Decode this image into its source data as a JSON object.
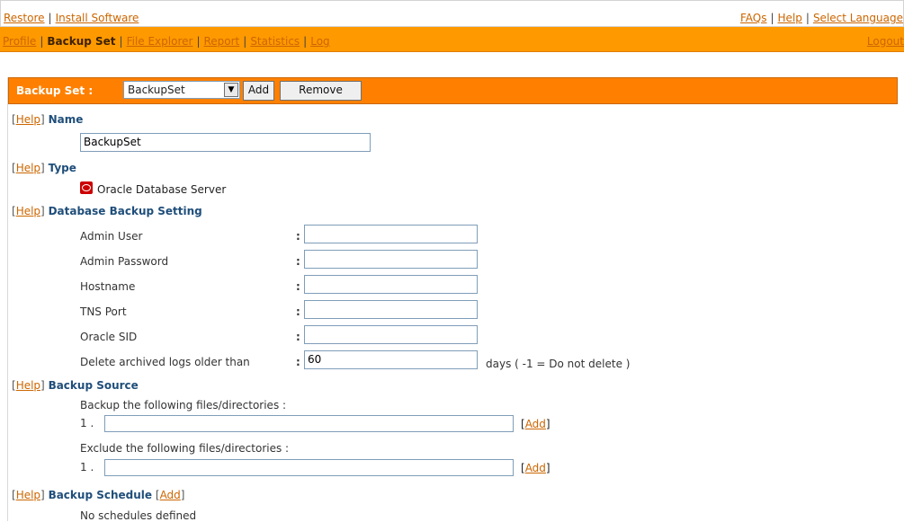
{
  "top": {
    "left_links": [
      "Restore",
      "Install Software"
    ],
    "right_links": [
      "FAQs",
      "Help",
      "Select Language"
    ]
  },
  "nav": {
    "items": [
      "Profile",
      "Backup Set",
      "File Explorer",
      "Report",
      "Statistics",
      "Log"
    ],
    "active": "Backup Set",
    "logout": "Logout"
  },
  "backup_set": {
    "label": "Backup Set :",
    "selected": "BackupSet",
    "add_button": "Add",
    "remove_button": "Remove"
  },
  "help_link": "Help",
  "name_section": {
    "title": "Name",
    "value": "BackupSet"
  },
  "type_section": {
    "title": "Type",
    "icon": "oracle-database-icon",
    "value": "Oracle Database Server"
  },
  "db_section": {
    "title": "Database Backup Setting",
    "fields": [
      {
        "label": "Admin User",
        "value": ""
      },
      {
        "label": "Admin Password",
        "value": ""
      },
      {
        "label": "Hostname",
        "value": ""
      },
      {
        "label": "TNS Port",
        "value": ""
      },
      {
        "label": "Oracle SID",
        "value": ""
      },
      {
        "label": "Delete archived logs older than",
        "value": "60"
      }
    ],
    "colon": ":",
    "days_note": "days ( -1 = Do not delete )"
  },
  "source_section": {
    "title": "Backup Source",
    "include_label": "Backup the following files/directories :",
    "exclude_label": "Exclude the following files/directories :",
    "index": "1 .",
    "add_link": "Add"
  },
  "schedule_section": {
    "title": "Backup Schedule",
    "add_link": "Add",
    "empty": "No schedules defined"
  },
  "colors": {
    "nav_bg": "#ff9900",
    "header_bg": "#ff8000",
    "link": "#cc6600",
    "section_title": "#1f4e7a"
  }
}
